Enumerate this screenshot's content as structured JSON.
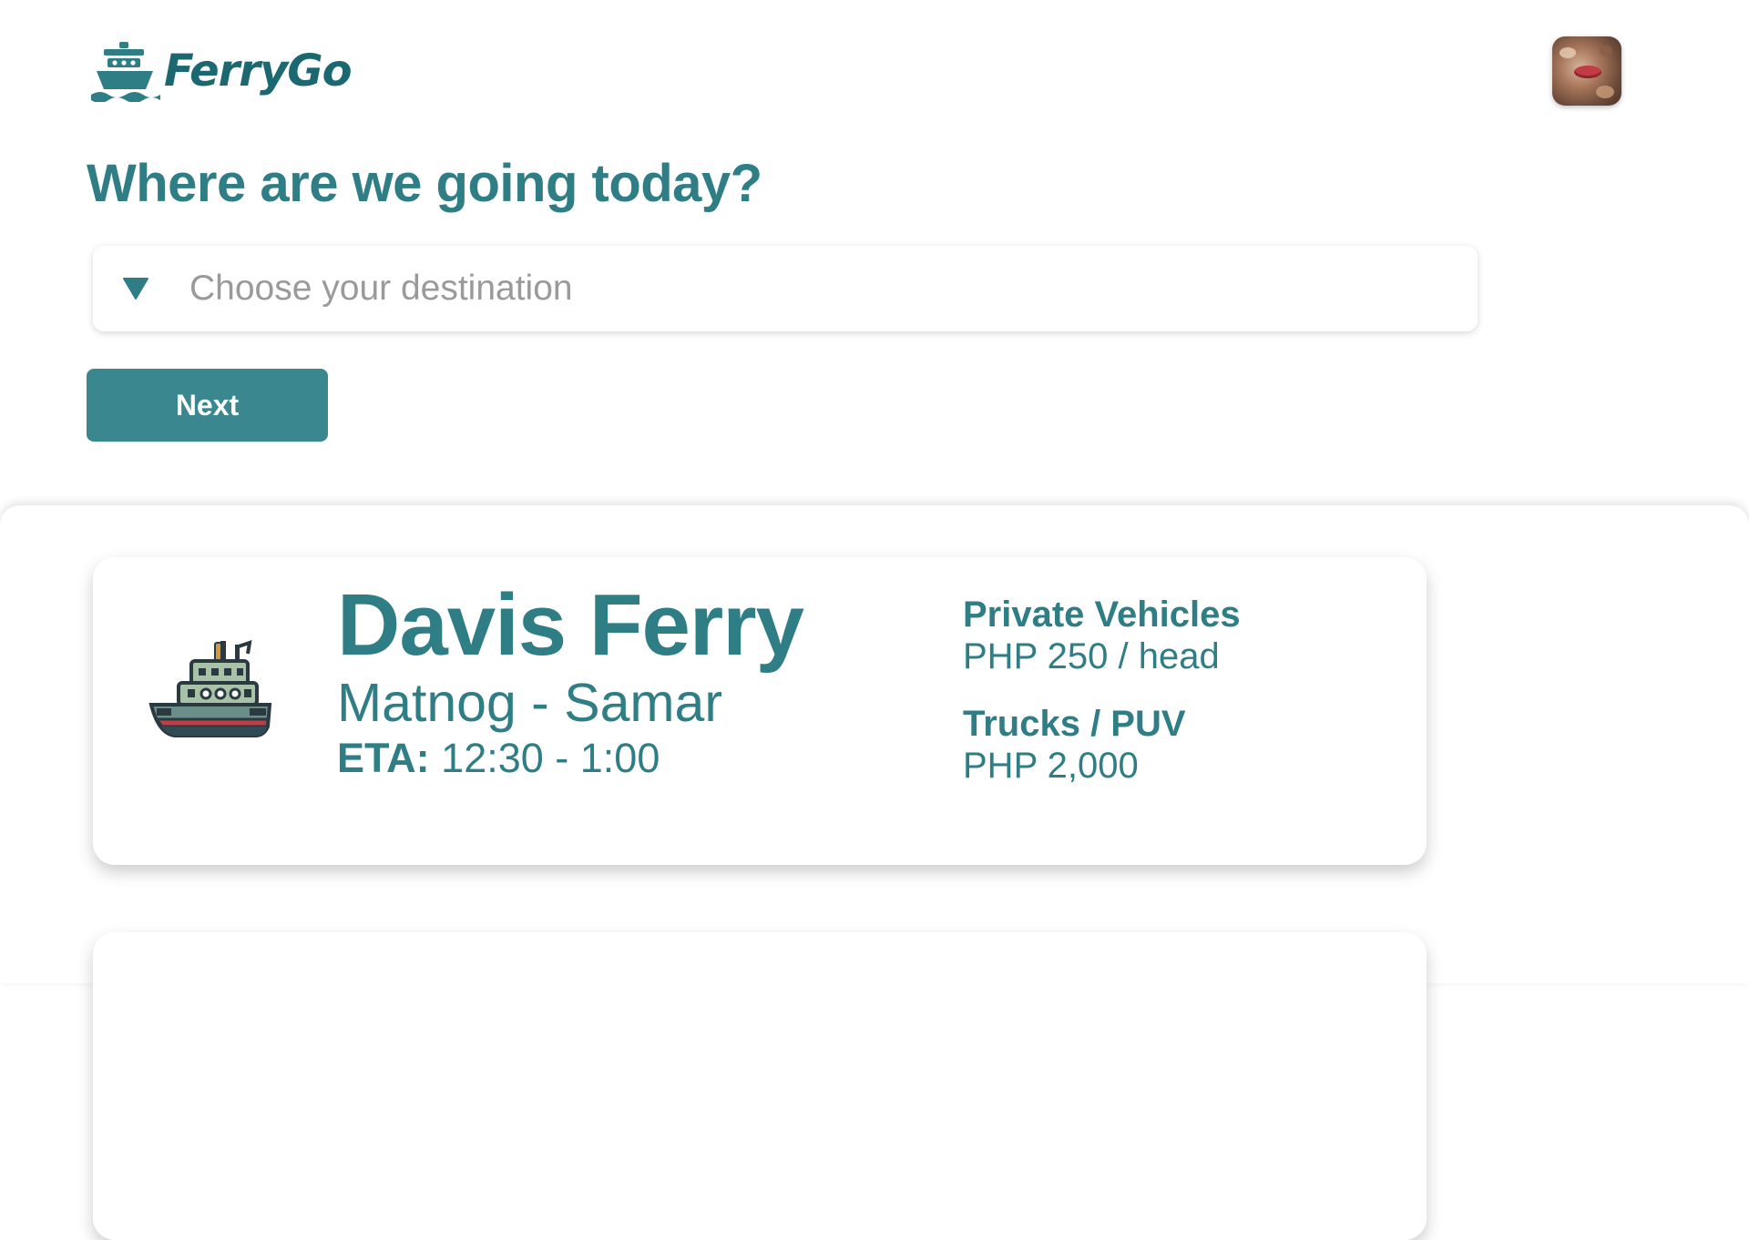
{
  "header": {
    "app_name": "FerryGo",
    "logo_icon": "ship-icon",
    "avatar_icon": "user-avatar"
  },
  "main": {
    "title": "Where are we going today?",
    "destination_select": {
      "placeholder": "Choose your destination",
      "icon": "dropdown-triangle-icon"
    },
    "next_label": "Next"
  },
  "ferries": [
    {
      "name": "Davis Ferry",
      "route": "Matnog - Samar",
      "eta_label": "ETA:",
      "eta_value": "12:30 - 1:00",
      "rates": [
        {
          "label": "Private Vehicles",
          "value": "PHP 250 / head"
        },
        {
          "label": "Trucks / PUV",
          "value": "PHP 2,000"
        }
      ]
    }
  ],
  "colors": {
    "brand": "#2f7d85",
    "logo_text": "#1c6870",
    "button": "#3a8790",
    "placeholder": "#9a9a9a"
  }
}
